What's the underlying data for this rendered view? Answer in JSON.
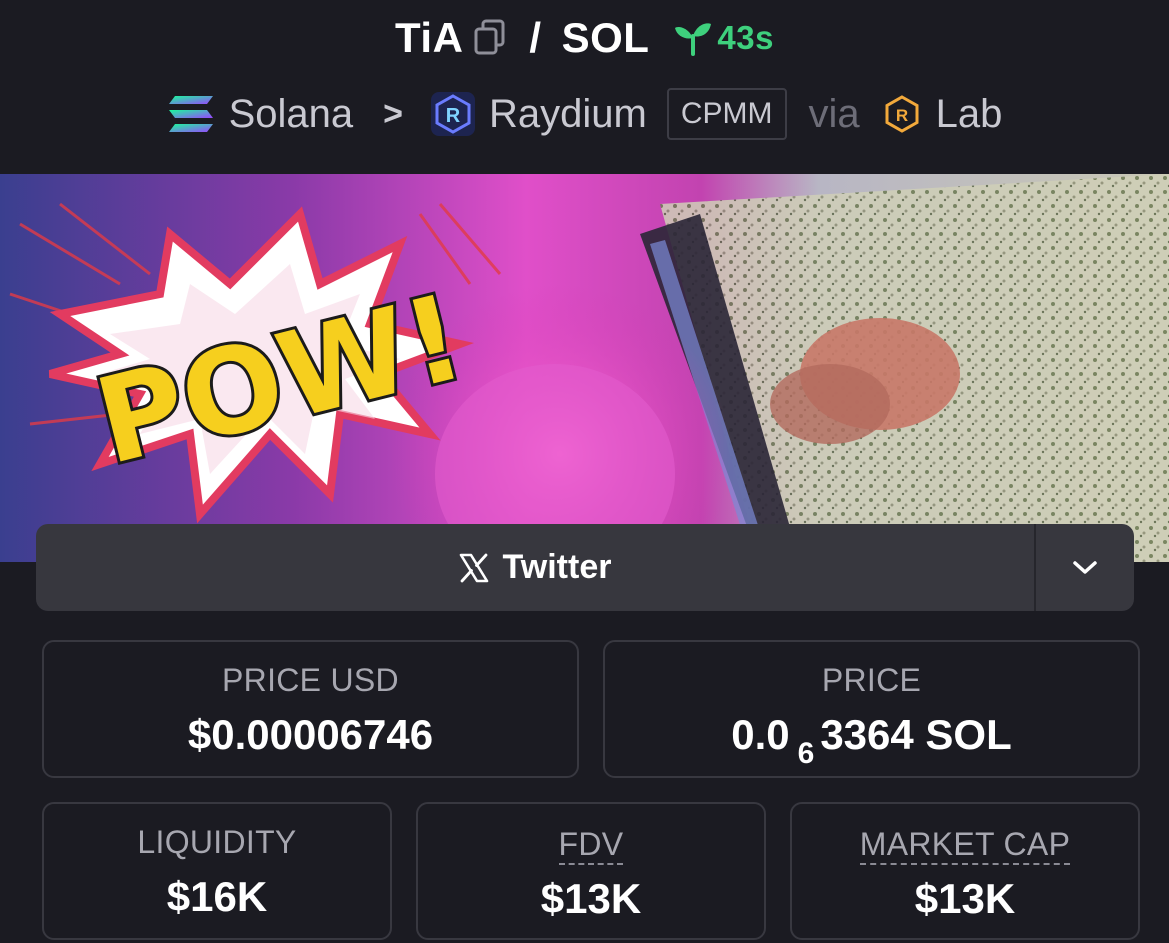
{
  "pair": {
    "base": "TiA",
    "separator": "/",
    "quote": "SOL",
    "age": "43s"
  },
  "breadcrumb": {
    "chain": "Solana",
    "dex": "Raydium",
    "pool_type": "CPMM",
    "via": "via",
    "launchpad": "Lab"
  },
  "banner": {
    "caption": "POW!"
  },
  "twitter": {
    "label": "Twitter"
  },
  "stats": {
    "price_usd": {
      "label": "PRICE USD",
      "value": "$0.00006746"
    },
    "price": {
      "label": "PRICE",
      "value_prefix": "0.0",
      "zero_count": "6",
      "value_suffix": "3364 SOL"
    },
    "liquidity": {
      "label": "LIQUIDITY",
      "value": "$16K"
    },
    "fdv": {
      "label": "FDV",
      "value": "$13K"
    },
    "market_cap": {
      "label": "MARKET CAP",
      "value": "$13K"
    }
  },
  "icons": {
    "copy": "copy-icon",
    "age": "sprout-icon",
    "chain": "solana-icon",
    "dex": "raydium-icon",
    "launchpad": "raydium-lab-icon",
    "twitter": "x-icon",
    "toggle": "chevron-down-icon"
  },
  "colors": {
    "background": "#1b1b22",
    "card_border": "#383840",
    "age_green": "#3ed07d",
    "twitter_bar": "#37373e"
  }
}
